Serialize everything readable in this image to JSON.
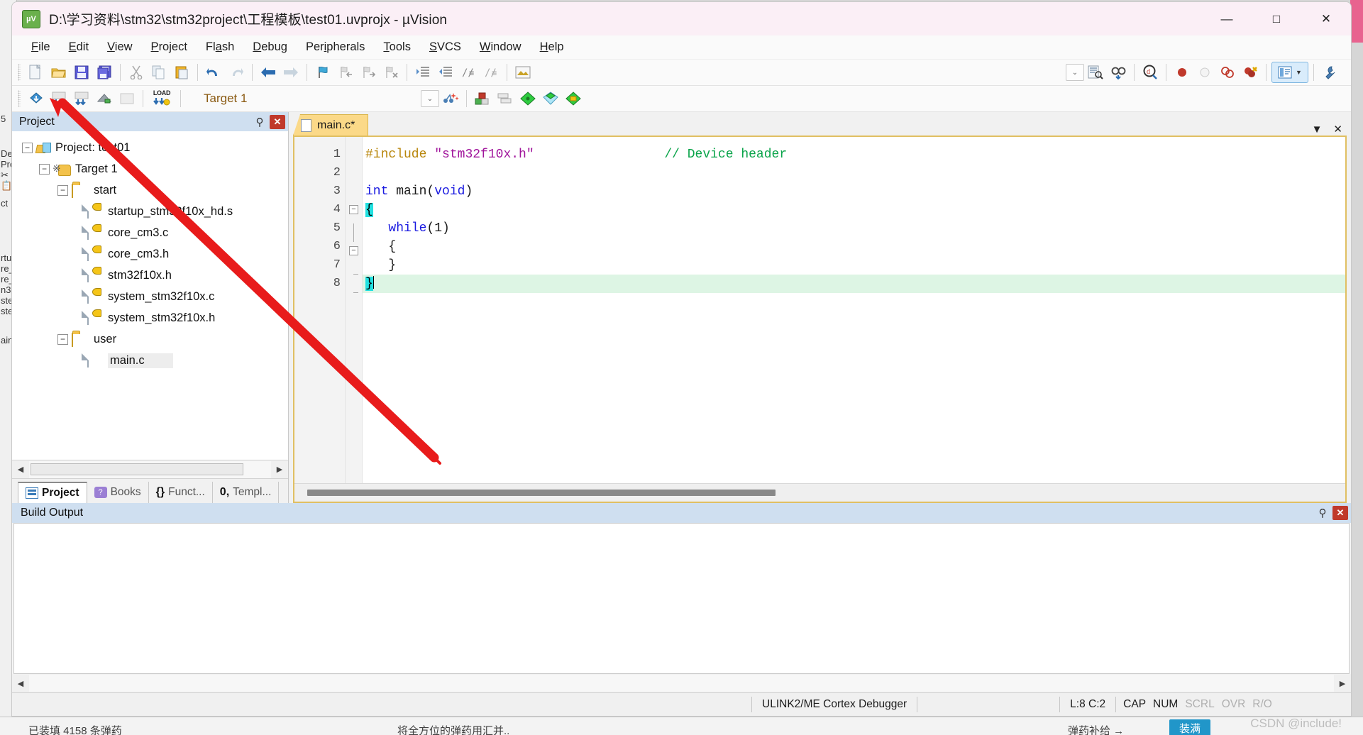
{
  "window": {
    "title": "D:\\学习资料\\stm32\\stm32project\\工程模板\\test01.uvprojx - µVision",
    "app_icon": "uvision-logo-icon",
    "minimize": "—",
    "maximize": "□",
    "close": "✕"
  },
  "menubar": {
    "items": [
      {
        "label": "File",
        "accel": "F"
      },
      {
        "label": "Edit",
        "accel": "E"
      },
      {
        "label": "View",
        "accel": "V"
      },
      {
        "label": "Project",
        "accel": "P"
      },
      {
        "label": "Flash",
        "accel": "a"
      },
      {
        "label": "Debug",
        "accel": "D"
      },
      {
        "label": "Peripherals",
        "accel": "i"
      },
      {
        "label": "Tools",
        "accel": "T"
      },
      {
        "label": "SVCS",
        "accel": "S"
      },
      {
        "label": "Window",
        "accel": "W"
      },
      {
        "label": "Help",
        "accel": "H"
      }
    ]
  },
  "toolbar_main": {
    "buttons": [
      {
        "name": "new-file-icon",
        "glyph": "📄"
      },
      {
        "name": "open-file-icon",
        "glyph": "📂"
      },
      {
        "name": "save-icon",
        "glyph": "💾"
      },
      {
        "name": "save-all-icon",
        "glyph": "💾"
      },
      {
        "name": "cut-icon",
        "glyph": "✂"
      },
      {
        "name": "copy-icon",
        "glyph": "⧉"
      },
      {
        "name": "paste-icon",
        "glyph": "📋"
      },
      {
        "name": "undo-icon",
        "glyph": "↶"
      },
      {
        "name": "redo-icon",
        "glyph": "↷"
      },
      {
        "name": "navigate-back-icon",
        "glyph": "←"
      },
      {
        "name": "navigate-forward-icon",
        "glyph": "→"
      },
      {
        "name": "bookmark-toggle-icon",
        "glyph": "⚑"
      },
      {
        "name": "bookmark-prev-icon",
        "glyph": "⚐"
      },
      {
        "name": "bookmark-next-icon",
        "glyph": "⚐"
      },
      {
        "name": "bookmark-clear-icon",
        "glyph": "⚐"
      },
      {
        "name": "indent-icon",
        "glyph": "⇥"
      },
      {
        "name": "outdent-icon",
        "glyph": "⇤"
      },
      {
        "name": "comment-icon",
        "glyph": "//"
      },
      {
        "name": "uncomment-icon",
        "glyph": "//"
      },
      {
        "name": "configure-icon",
        "glyph": "🖼"
      }
    ],
    "right_buttons": [
      {
        "name": "toolbox-dropdown-icon",
        "glyph": "⌄"
      },
      {
        "name": "find-in-files-icon",
        "glyph": "🗎"
      },
      {
        "name": "browse-symbol-icon",
        "glyph": "🔭"
      },
      {
        "name": "find-icon",
        "glyph": "🔍"
      },
      {
        "name": "insert-breakpoint-icon",
        "glyph": "●"
      },
      {
        "name": "disable-breakpoint-icon",
        "glyph": "○"
      },
      {
        "name": "disable-all-breakpoints-icon",
        "glyph": "◌"
      },
      {
        "name": "kill-all-breakpoints-icon",
        "glyph": "●"
      },
      {
        "name": "project-window-toggle-icon",
        "glyph": "▤"
      },
      {
        "name": "configuration-wizard-icon",
        "glyph": "🔧"
      }
    ]
  },
  "toolbar_build": {
    "buttons": [
      {
        "name": "translate-icon",
        "glyph": "◈"
      },
      {
        "name": "build-icon",
        "glyph": "▦"
      },
      {
        "name": "rebuild-icon",
        "glyph": "▩"
      },
      {
        "name": "batch-build-icon",
        "glyph": "◣"
      },
      {
        "name": "stop-build-icon",
        "glyph": "▥"
      },
      {
        "name": "download-icon",
        "glyph": "LOAD"
      }
    ],
    "target_label": "Target 1",
    "target_dropdown_icon": "chevron-down-icon",
    "after_buttons": [
      {
        "name": "target-options-icon",
        "glyph": "✨"
      },
      {
        "name": "manage-project-items-icon",
        "glyph": "▣"
      },
      {
        "name": "manage-multi-project-icon",
        "glyph": "▤"
      },
      {
        "name": "pack-installer-icon",
        "glyph": "◆"
      },
      {
        "name": "manage-runtime-env-icon",
        "glyph": "◆"
      },
      {
        "name": "pack-manage-icon",
        "glyph": "◆"
      }
    ]
  },
  "project_panel": {
    "title": "Project",
    "pin_icon": "pin-icon",
    "close_icon": "close-icon",
    "tree": [
      {
        "level": 0,
        "label": "Project: test01",
        "icon": "project-icon",
        "expander": "−"
      },
      {
        "level": 1,
        "label": "Target 1",
        "icon": "target-folder-icon",
        "expander": "−"
      },
      {
        "level": 2,
        "label": "start",
        "icon": "folder-icon",
        "expander": "−"
      },
      {
        "level": 3,
        "label": "startup_stm32f10x_hd.s",
        "icon": "source-file-key-icon",
        "expander": ""
      },
      {
        "level": 3,
        "label": "core_cm3.c",
        "icon": "source-file-key-icon",
        "expander": ""
      },
      {
        "level": 3,
        "label": "core_cm3.h",
        "icon": "source-file-key-icon",
        "expander": ""
      },
      {
        "level": 3,
        "label": "stm32f10x.h",
        "icon": "source-file-key-icon",
        "expander": ""
      },
      {
        "level": 3,
        "label": "system_stm32f10x.c",
        "icon": "source-file-key-icon",
        "expander": ""
      },
      {
        "level": 3,
        "label": "system_stm32f10x.h",
        "icon": "source-file-key-icon",
        "expander": ""
      },
      {
        "level": 2,
        "label": "user",
        "icon": "folder-icon",
        "expander": "−"
      },
      {
        "level": 3,
        "label": "main.c",
        "icon": "source-file-icon",
        "expander": "",
        "selected": true
      }
    ],
    "tabs": [
      {
        "label": "Project",
        "icon": "project-tab-icon",
        "active": true
      },
      {
        "label": "Books",
        "icon": "books-tab-icon",
        "active": false
      },
      {
        "label": "Funct...",
        "icon": "functions-tab-icon",
        "active": false
      },
      {
        "label": "Templ...",
        "icon": "templates-tab-icon",
        "active": false
      }
    ],
    "funct_prefix": "{}",
    "templ_prefix": "0,"
  },
  "editor": {
    "tab": {
      "label": "main.c*",
      "icon": "document-icon"
    },
    "tab_controls": [
      {
        "name": "editor-dropdown-icon",
        "glyph": "▼"
      },
      {
        "name": "editor-close-icon",
        "glyph": "✕"
      }
    ],
    "lines": [
      {
        "num": "1",
        "fold": "",
        "highlight": false,
        "tokens": [
          {
            "t": "#include",
            "c": "k-pre"
          },
          {
            "t": " ",
            "c": "k-plain"
          },
          {
            "t": "\"stm32f10x.h\"",
            "c": "k-str"
          },
          {
            "t": "                 ",
            "c": "k-plain"
          },
          {
            "t": "// Device header",
            "c": "k-com"
          }
        ]
      },
      {
        "num": "2",
        "fold": "",
        "highlight": false,
        "tokens": []
      },
      {
        "num": "3",
        "fold": "",
        "highlight": false,
        "tokens": [
          {
            "t": "int",
            "c": "k-type"
          },
          {
            "t": " main(",
            "c": "k-plain"
          },
          {
            "t": "void",
            "c": "k-type"
          },
          {
            "t": ")",
            "c": "k-plain"
          }
        ]
      },
      {
        "num": "4",
        "fold": "box-minus",
        "highlight": false,
        "tokens": [
          {
            "t": "{",
            "c": "brace-hl"
          }
        ]
      },
      {
        "num": "5",
        "fold": "bar",
        "highlight": false,
        "tokens": [
          {
            "t": "   ",
            "c": "k-plain"
          },
          {
            "t": "while",
            "c": "k-kw"
          },
          {
            "t": "(1)",
            "c": "k-plain"
          }
        ]
      },
      {
        "num": "6",
        "fold": "box-minus",
        "highlight": false,
        "tokens": [
          {
            "t": "   {",
            "c": "k-plain"
          }
        ]
      },
      {
        "num": "7",
        "fold": "tick",
        "highlight": false,
        "tokens": [
          {
            "t": "   }",
            "c": "k-plain"
          }
        ]
      },
      {
        "num": "8",
        "fold": "end",
        "highlight": true,
        "tokens": [
          {
            "t": "}",
            "c": "brace-hl"
          }
        ]
      }
    ]
  },
  "build_output": {
    "title": "Build Output",
    "pin_icon": "pin-icon",
    "close_icon": "close-icon",
    "content": ""
  },
  "statusbar": {
    "debugger": "ULINK2/ME Cortex Debugger",
    "cursor": "L:8 C:2",
    "flags": [
      {
        "label": "CAP",
        "on": true
      },
      {
        "label": "NUM",
        "on": true
      },
      {
        "label": "SCRL",
        "on": false
      },
      {
        "label": "OVR",
        "on": false
      },
      {
        "label": "R/O",
        "on": false
      }
    ]
  },
  "background": {
    "left_fragments": [
      "5",
      "De",
      "Pro",
      "✂",
      "📋",
      "ct",
      "rtu",
      "re_",
      "re_",
      "n3",
      "ste",
      "ste",
      "ain"
    ],
    "bottom_left": "已装填 4158 条弹药",
    "bottom_mid": "将全方位的弹药用汇并..",
    "bottom_right": "弹药补给 →",
    "bottom_button": "装满"
  },
  "watermark": "CSDN @include!",
  "colors": {
    "title_bg": "#fbeff6",
    "panel_header": "#cfdff0",
    "tab_active": "#fbd988",
    "editor_border": "#e0bf62",
    "annotation": "#e81b1b",
    "highlight_line": "#ddf5e4",
    "brace_match": "#22e0e0",
    "comment": "#0aa44a",
    "string": "#a0149b",
    "keyword": "#1a1ae0",
    "preproc": "#b8860b"
  }
}
